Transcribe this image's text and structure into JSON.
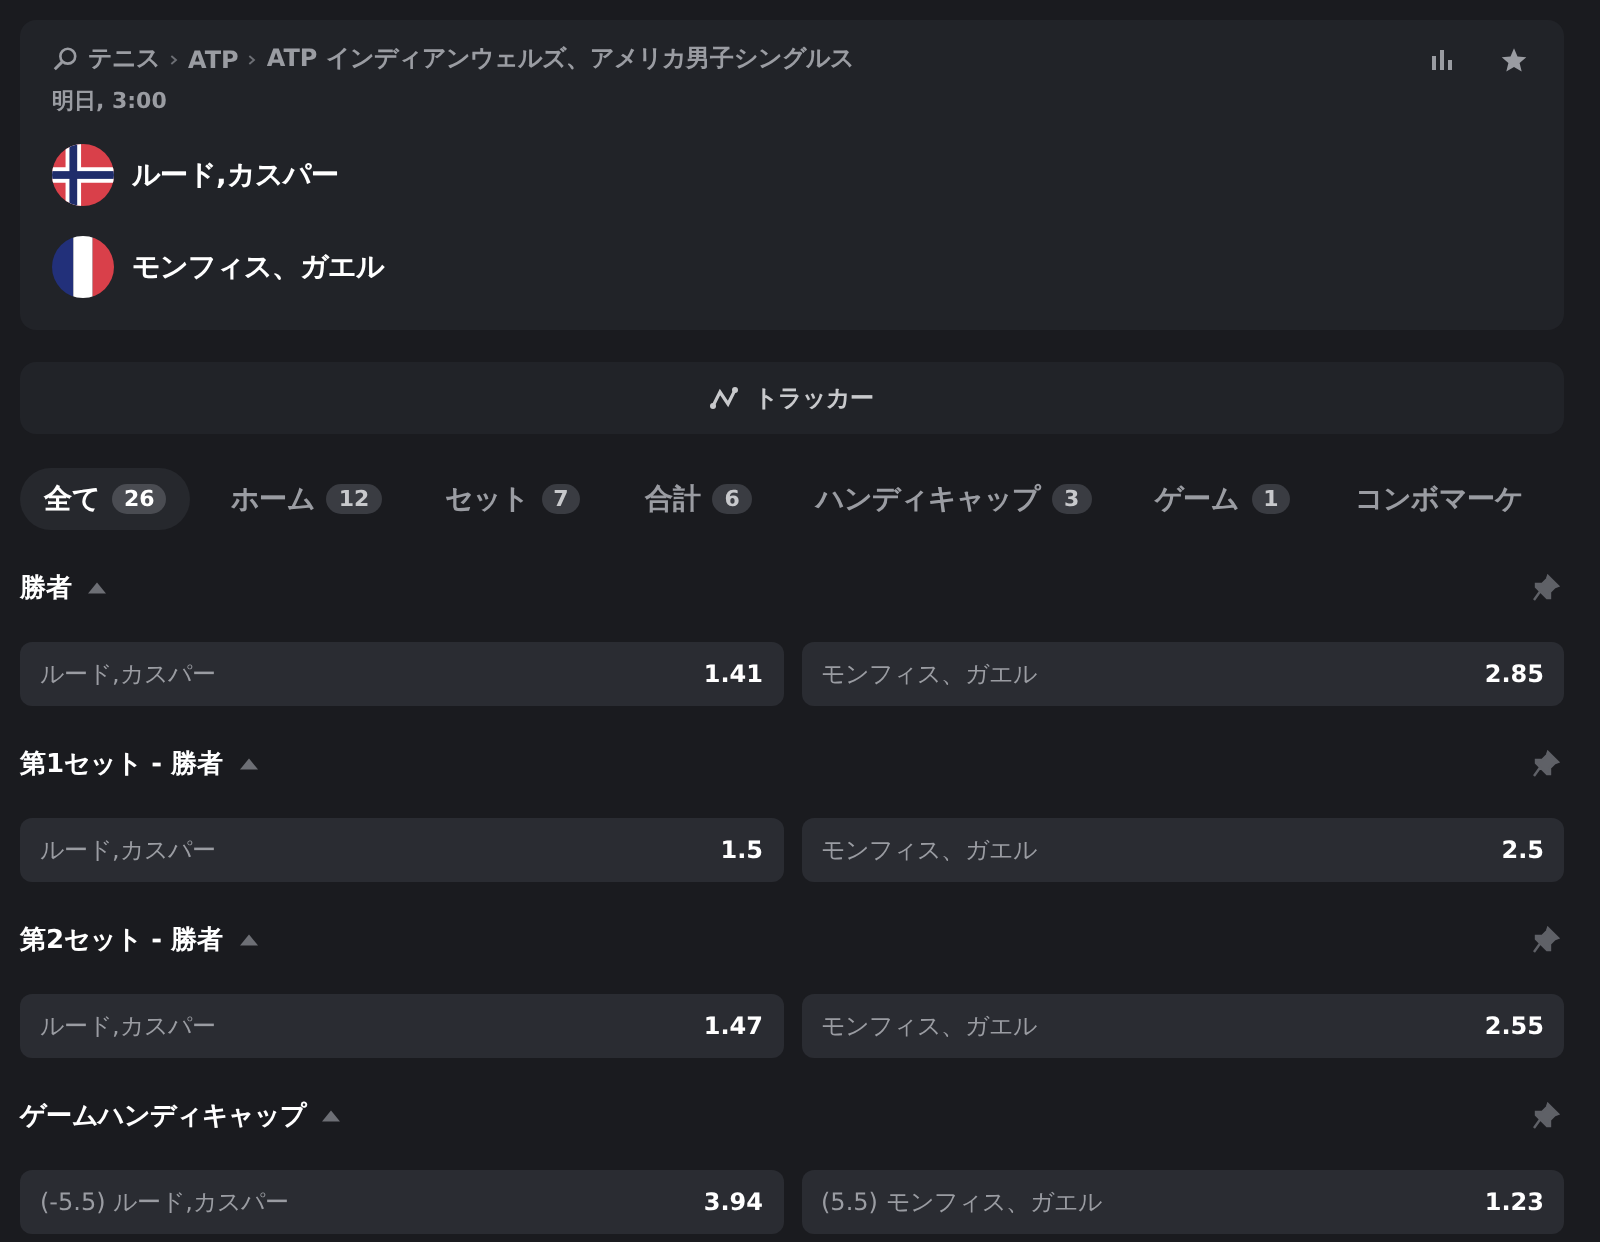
{
  "event": {
    "breadcrumb": [
      "テニス",
      "ATP",
      "ATP インディアンウェルズ、アメリカ男子シングルス"
    ],
    "time": "明日, 3:00",
    "players": [
      {
        "name": "ルード,カスパー",
        "kind": "norway"
      },
      {
        "name": "モンフィス、ガエル",
        "kind": "france"
      }
    ]
  },
  "tracker": {
    "label": "トラッカー"
  },
  "tabs": [
    {
      "label": "全て",
      "count": "26",
      "selected": true
    },
    {
      "label": "ホーム",
      "count": "12",
      "selected": false
    },
    {
      "label": "セット",
      "count": "7",
      "selected": false
    },
    {
      "label": "合計",
      "count": "6",
      "selected": false
    },
    {
      "label": "ハンディキャップ",
      "count": "3",
      "selected": false
    },
    {
      "label": "ゲーム",
      "count": "1",
      "selected": false
    },
    {
      "label": "コンボマーケ",
      "selected": false
    }
  ],
  "markets": [
    {
      "title": "勝者",
      "expanded": true,
      "odds": [
        {
          "label": "ルード,カスパー",
          "price": "1.41"
        },
        {
          "label": "モンフィス、ガエル",
          "price": "2.85"
        }
      ]
    },
    {
      "title": "第1セット - 勝者",
      "expanded": true,
      "odds": [
        {
          "label": "ルード,カスパー",
          "price": "1.5"
        },
        {
          "label": "モンフィス、ガエル",
          "price": "2.5"
        }
      ]
    },
    {
      "title": "第2セット - 勝者",
      "expanded": true,
      "odds": [
        {
          "label": "ルード,カスパー",
          "price": "1.47"
        },
        {
          "label": "モンフィス、ガエル",
          "price": "2.55"
        }
      ]
    },
    {
      "title": "ゲームハンディキャップ",
      "expanded": true,
      "odds": [
        {
          "label": "(-5.5) ルード,カスパー",
          "price": "3.94"
        },
        {
          "label": "(5.5) モンフィス、ガエル",
          "price": "1.23"
        }
      ]
    }
  ]
}
